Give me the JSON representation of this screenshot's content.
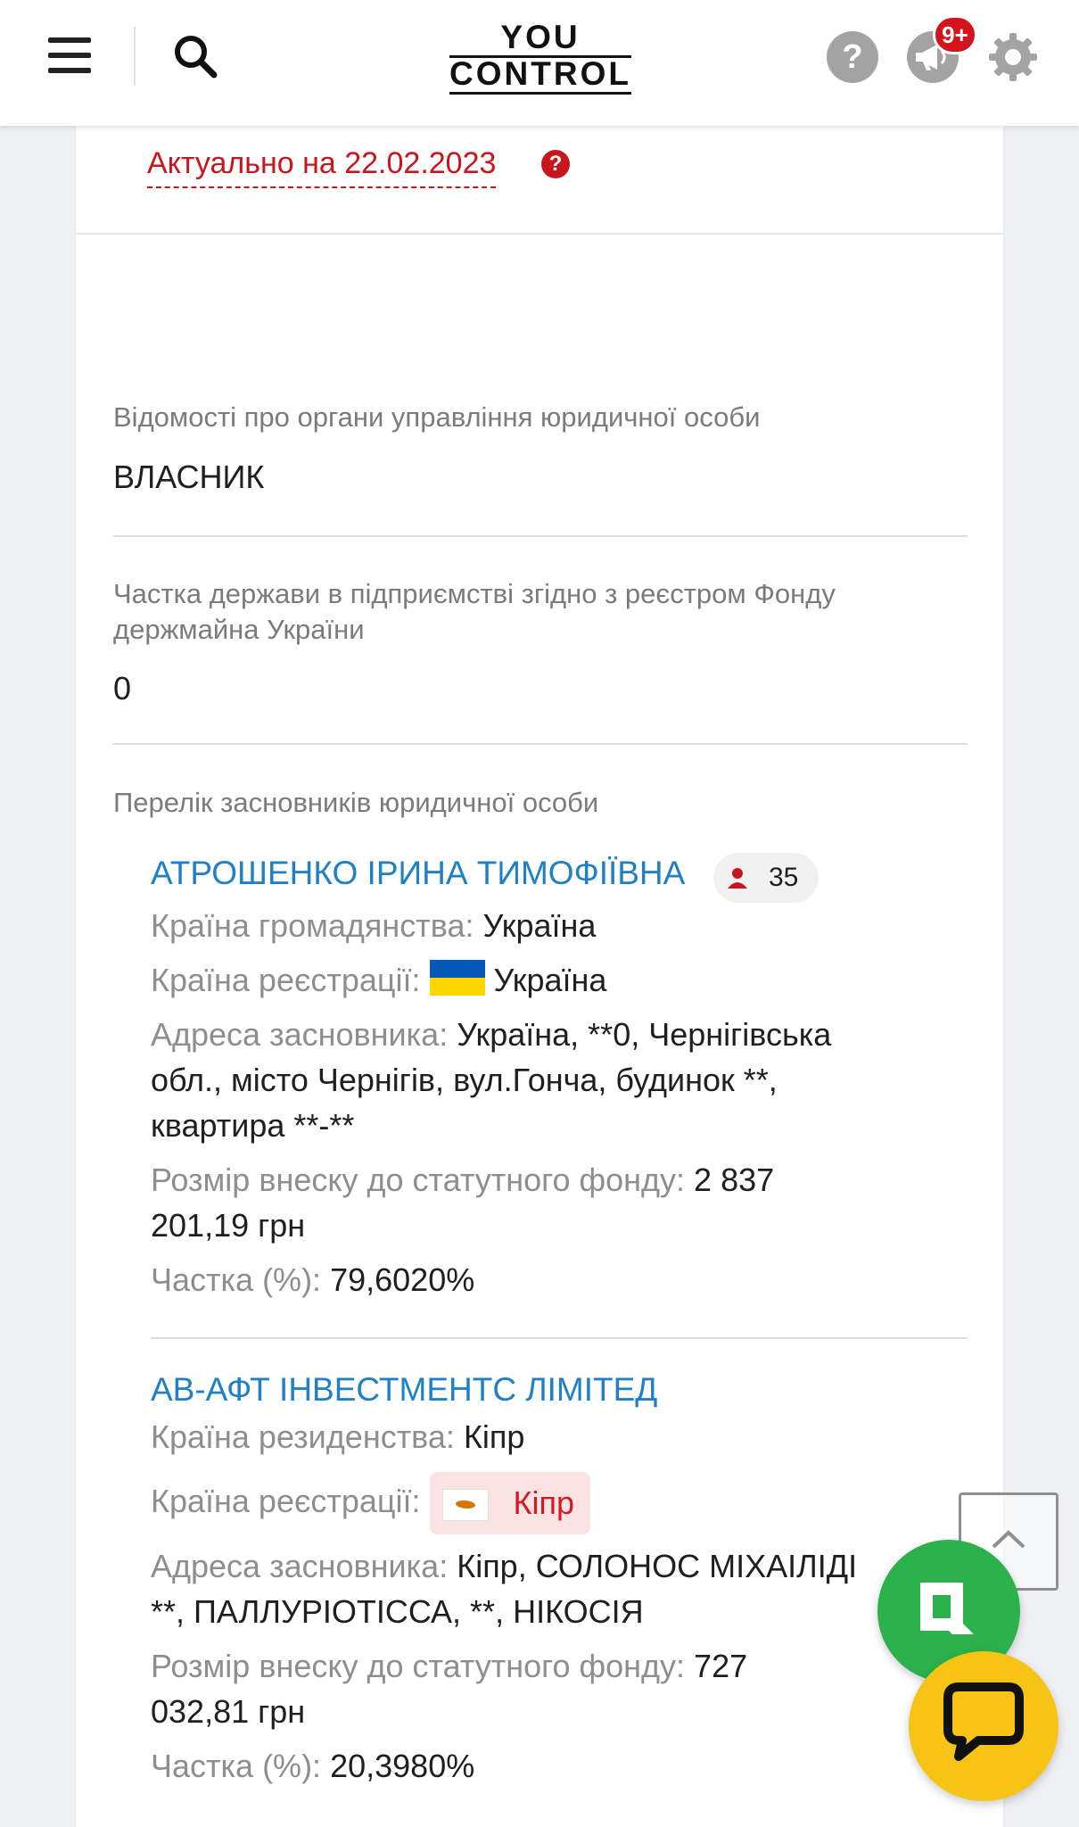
{
  "header": {
    "logo_top": "YOU",
    "logo_bottom": "CONTROL",
    "notifications_badge": "9+",
    "help_glyph": "?"
  },
  "icons": {
    "menu": "menu-icon",
    "search": "search-icon",
    "help": "help-icon",
    "news": "megaphone-icon",
    "settings": "gear-icon",
    "scroll_top": "chevron-up-icon",
    "chat": "chat-icon",
    "youcontrol_app": "app-icon"
  },
  "colors": {
    "accent_red": "#c9151e",
    "link_blue": "#1f80c8",
    "chat_yellow": "#f7c314",
    "app_green": "#2bb24c"
  },
  "status": {
    "actual_text": "Актуально на 22.02.2023",
    "help_glyph": "?"
  },
  "sections": {
    "management": {
      "label": "Відомості про органи управління юридичної особи",
      "value": "ВЛАСНИК"
    },
    "state_share": {
      "label_line1": "Частка держави в підприємстві згідно з реєстром Фонду",
      "label_line2": "держмайна України",
      "value": "0"
    },
    "founders_label": "Перелік засновників юридичної особи"
  },
  "founders": [
    {
      "name": "АТРОШЕНКО ІРИНА ТИМОФІЇВНА",
      "person_count": "35",
      "citizenship_key": "Країна громадянства:",
      "citizenship_value": "Україна",
      "registration_key": "Країна реєстрації:",
      "registration_value": "Україна",
      "address_key": "Адреса засновника:",
      "address_line1": "Україна, **0, Чернігівська",
      "address_line2": "обл., місто Чернігів, вул.Гонча, будинок **,",
      "address_line3": "квартира **-**",
      "contribution_key": "Розмір внеску до статутного фонду:",
      "contribution_line1": "2 837",
      "contribution_line2": "201,19 грн",
      "share_key": "Частка (%):",
      "share_value": "79,6020%"
    },
    {
      "name": "АВ-АФТ ІНВЕСТМЕНТС ЛІМІТЕД",
      "residence_key": "Країна резиденства:",
      "residence_value": "Кіпр",
      "registration_key": "Країна реєстрації:",
      "registration_value": "Кіпр",
      "address_key": "Адреса засновника:",
      "address_line1": "Кіпр, СОЛОНОС МІХАІЛІДІ",
      "address_line2": "**, ПАЛЛУРІОТІССА, **, НІКОСІЯ",
      "contribution_key": "Розмір внеску до статутного фонду:",
      "contribution_line1": "727",
      "contribution_line2": "032,81 грн",
      "share_key": "Частка (%):",
      "share_value": "20,3980%"
    }
  ]
}
